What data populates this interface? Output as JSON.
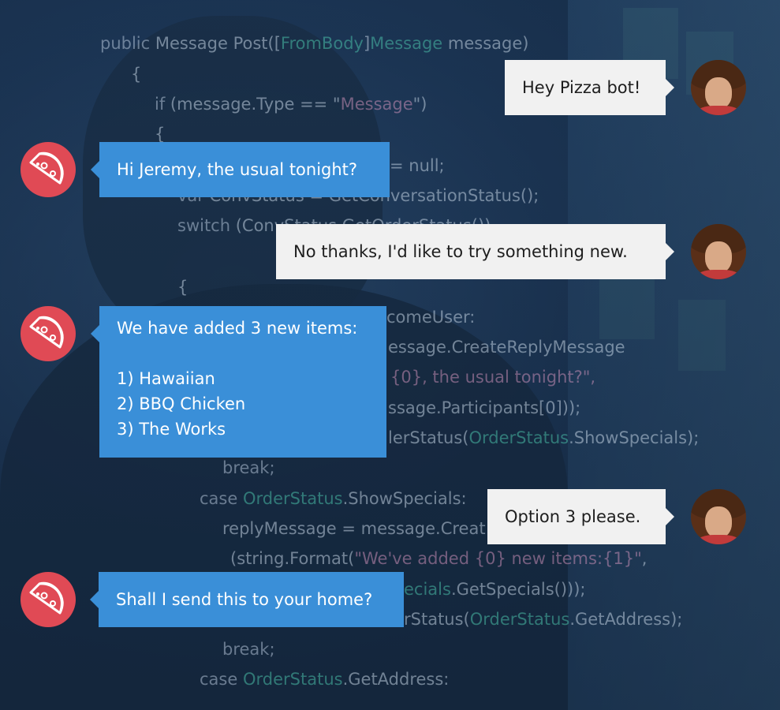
{
  "code": {
    "line_1": {
      "kw": "public",
      "text_a": " Message Post([",
      "attr": "FromBody",
      "text_b": "]",
      "type": "Message",
      "text_c": " message)"
    },
    "line_2": "{",
    "line_3": {
      "kw": "if",
      "text_a": " (message.Type == \"",
      "str": "Message",
      "text_b": "\")"
    },
    "line_4": "{",
    "line_5": "= null;",
    "line_6": {
      "kw": "var",
      "text_a": " ConvStatus = GetConversationStatus();"
    },
    "line_7": {
      "kw": "switch",
      "text_a": " (ConvStatus.GetOrderStatus())"
    },
    "line_8": "{",
    "line_9": "comeUser:",
    "line_10": "essage.CreateReplyMessage",
    "line_11": {
      "str": "{0}, the usual tonight?\","
    },
    "line_12": "ssage.Participants[0]));",
    "line_13": {
      "text_a": "lerStatus(",
      "type": "OrderStatus",
      "text_b": ".ShowSpecials);"
    },
    "line_14": {
      "kw": "break;"
    },
    "line_15": {
      "kw": "case",
      "text_a": " ",
      "type": "OrderStatus",
      "text_b": ".ShowSpecials:"
    },
    "line_16": "replyMessage = message.Creat",
    "line_17": {
      "text_a": "(string.Format(",
      "str": "\"We've added {0} new items:{1}\"",
      "text_b": ","
    },
    "line_18": {
      "type": "ecials",
      "text_a": ".GetSpecials()));"
    },
    "line_19": {
      "text_a": "rStatus(",
      "type": "OrderStatus",
      "text_b": ".GetAddress);"
    },
    "line_20": {
      "kw": "break;"
    },
    "line_21": {
      "kw": "case",
      "text_a": " ",
      "type": "OrderStatus",
      "text_b": ".GetAddress:"
    }
  },
  "chat": {
    "messages": [
      {
        "sender": "user",
        "text": "Hey Pizza bot!"
      },
      {
        "sender": "bot",
        "text": "Hi Jeremy, the usual tonight?"
      },
      {
        "sender": "user",
        "text": "No thanks, I'd like to try something new."
      },
      {
        "sender": "bot",
        "lines": [
          "We have added 3 new items:",
          "",
          "1) Hawaiian",
          "2) BBQ Chicken",
          "3) The Works"
        ]
      },
      {
        "sender": "user",
        "text": "Option 3 please."
      },
      {
        "sender": "bot",
        "text": "Shall I send this to your home?"
      }
    ]
  },
  "colors": {
    "bot_bubble": "#3a8fd8",
    "user_bubble": "#f1f1f1",
    "bot_avatar": "#e04a55",
    "background": "#1c3656"
  },
  "icons": {
    "bot_avatar": "pizza-slice-icon",
    "user_avatar": "user-photo-avatar"
  }
}
